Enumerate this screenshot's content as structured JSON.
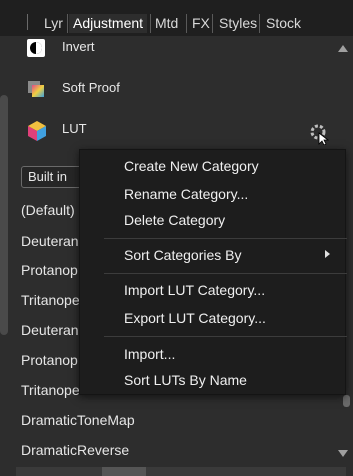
{
  "tabs": [
    {
      "label": "Lyr",
      "active": false
    },
    {
      "label": "Adjustment",
      "active": true
    },
    {
      "label": "Mtd",
      "active": false
    },
    {
      "label": "FX",
      "active": false
    },
    {
      "label": "Styles",
      "active": false
    },
    {
      "label": "Stock",
      "active": false
    }
  ],
  "adjustments": [
    {
      "label": "Invert",
      "icon": "invert-icon"
    },
    {
      "label": "Soft Proof",
      "icon": "soft-proof-icon"
    },
    {
      "label": "LUT",
      "icon": "lut-cube-icon"
    }
  ],
  "category_select": {
    "value": "Built in"
  },
  "luts": [
    "(Default)",
    "Deuteran",
    "Protanop",
    "Tritanope",
    "Deuteran",
    "Protanop",
    "Tritanope",
    "DramaticToneMap",
    "DramaticReverse"
  ],
  "context_menu": {
    "items": [
      "Create New Category",
      "Rename Category...",
      "Delete Category",
      "Sort Categories By",
      "Import LUT Category...",
      "Export LUT Category...",
      "Import...",
      "Sort LUTs By Name"
    ]
  },
  "colors": {
    "panel_bg": "#2d2d2d",
    "tabbar_bg": "#1f1f1f",
    "menu_bg": "#1d1d1d"
  }
}
